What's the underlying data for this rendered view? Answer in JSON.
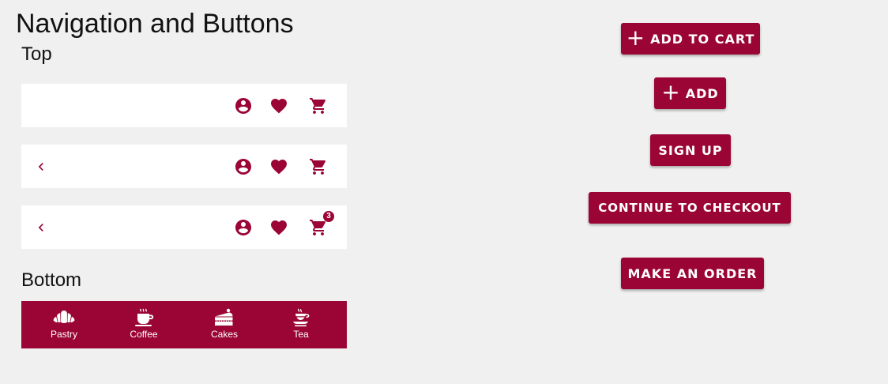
{
  "page": {
    "title": "Navigation and Buttons"
  },
  "sections": {
    "top_label": "Top",
    "bottom_label": "Bottom"
  },
  "top_bars": [
    {
      "has_back": false,
      "cart_badge": ""
    },
    {
      "has_back": true,
      "cart_badge": ""
    },
    {
      "has_back": true,
      "cart_badge": "3"
    }
  ],
  "icons": {
    "back": "chevron-left-icon",
    "account": "account-circle-icon",
    "favorite": "heart-icon",
    "cart": "shopping-cart-icon"
  },
  "bottom_nav": {
    "items": [
      {
        "label": "Pastry",
        "icon": "croissant-icon"
      },
      {
        "label": "Coffee",
        "icon": "coffee-cup-icon"
      },
      {
        "label": "Cakes",
        "icon": "cake-slice-icon"
      },
      {
        "label": "Tea",
        "icon": "tea-cup-icon"
      }
    ]
  },
  "buttons": {
    "add_to_cart": "ADD TO CART",
    "add": "ADD",
    "sign_up": "SIGN UP",
    "continue_to_checkout": "CONTINUE TO CHECKOUT",
    "make_an_order": "MAKE AN ORDER",
    "plus_glyph": "+"
  },
  "colors": {
    "accent": "#9b0536",
    "background": "#f0f0f0",
    "surface": "#ffffff"
  }
}
